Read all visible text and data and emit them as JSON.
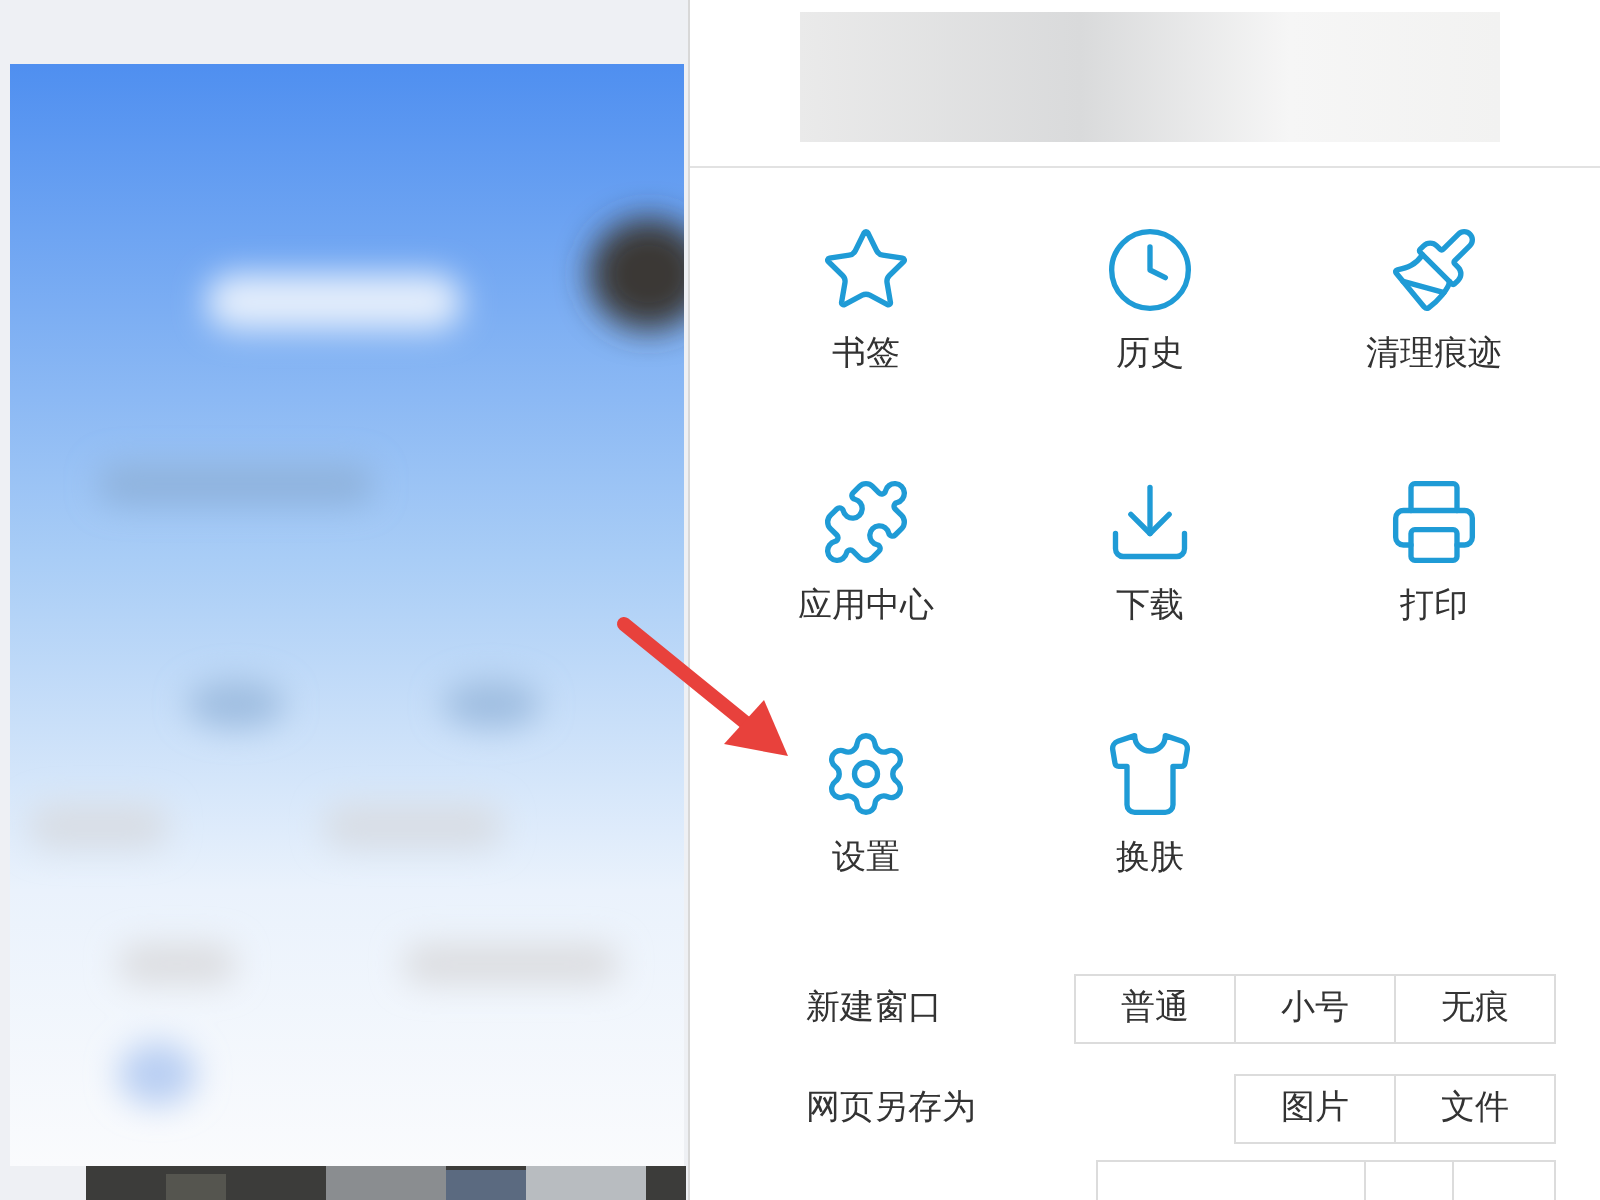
{
  "tools": [
    {
      "kind": "star",
      "label": "书签"
    },
    {
      "kind": "clock",
      "label": "历史"
    },
    {
      "kind": "brush",
      "label": "清理痕迹"
    },
    {
      "kind": "puzzle",
      "label": "应用中心"
    },
    {
      "kind": "download",
      "label": "下载"
    },
    {
      "kind": "printer",
      "label": "打印"
    },
    {
      "kind": "gear",
      "label": "设置"
    },
    {
      "kind": "shirt",
      "label": "换肤"
    }
  ],
  "option_rows": [
    {
      "label": "新建窗口",
      "options": [
        "普通",
        "小号",
        "无痕"
      ]
    },
    {
      "label": "网页另存为",
      "options": [
        "图片",
        "文件"
      ]
    }
  ]
}
